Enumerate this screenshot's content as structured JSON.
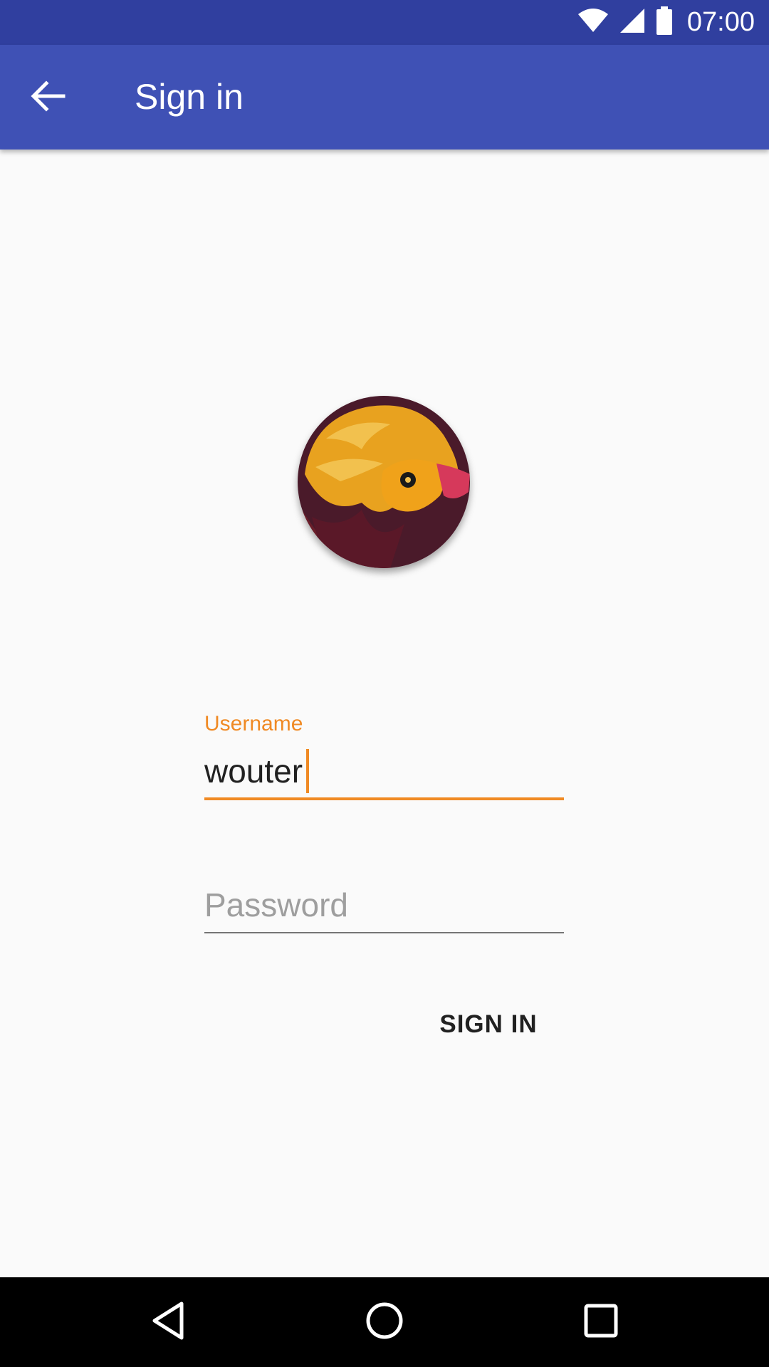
{
  "status_bar": {
    "time": "07:00",
    "icons": [
      "wifi-icon",
      "signal-icon",
      "battery-icon"
    ]
  },
  "app_bar": {
    "title": "Sign in",
    "back_icon": "arrow-back-icon"
  },
  "avatar": {
    "description_icon": "bird-avatar-icon"
  },
  "form": {
    "username": {
      "label": "Username",
      "value": "wouter"
    },
    "password": {
      "placeholder": "Password",
      "value": ""
    },
    "submit_label": "SIGN IN"
  },
  "nav_bar": {
    "icons": [
      "back-triangle-icon",
      "home-circle-icon",
      "recents-square-icon"
    ]
  },
  "colors": {
    "primary_dark": "#303f9f",
    "primary": "#3f51b5",
    "accent": "#f08a24",
    "background": "#fafafa"
  }
}
